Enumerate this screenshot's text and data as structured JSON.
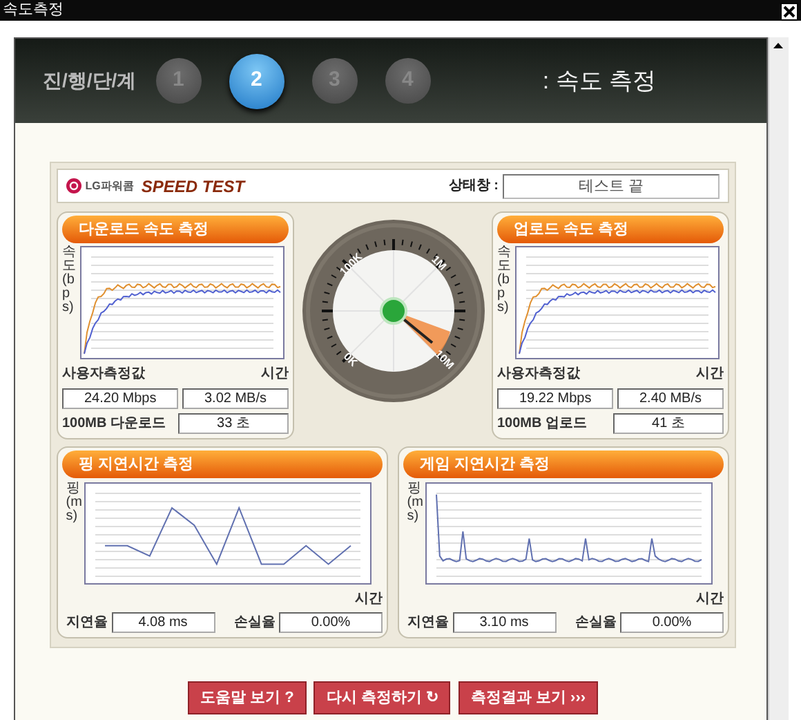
{
  "window": {
    "title": "속도측정"
  },
  "steps": {
    "label": "진/행/단/계",
    "items": [
      {
        "label": "1",
        "selected": false
      },
      {
        "label": "2",
        "selected": true
      },
      {
        "label": "3",
        "selected": false
      },
      {
        "label": "4",
        "selected": false
      }
    ],
    "current": ": 속도 측정"
  },
  "header": {
    "logo": "LG파워콤",
    "title": "SPEED TEST",
    "status_label": "상태창 :",
    "status_value": "테스트 끝"
  },
  "download": {
    "title": "다운로드 속도 측정",
    "ylabel": "속도(bps)",
    "xlabel": "시간",
    "measured_label": "사용자측정값",
    "mbps": "24.20 Mbps",
    "mbs": "3.02 MB/s",
    "time_label": "100MB 다운로드",
    "time": "33 초"
  },
  "gauge": {
    "labels": [
      "100K",
      "1M",
      "10M",
      "0K"
    ]
  },
  "upload": {
    "title": "업로드 속도 측정",
    "ylabel": "속도(bps)",
    "xlabel": "시간",
    "measured_label": "사용자측정값",
    "mbps": "19.22 Mbps",
    "mbs": "2.40 MB/s",
    "time_label": "100MB 업로드",
    "time": "41 초"
  },
  "ping": {
    "title": "핑 지연시간 측정",
    "ylabel": "핑(ms)",
    "xlabel": "시간",
    "latency_label": "지연율",
    "latency": "4.08 ms",
    "loss_label": "손실율",
    "loss": "0.00%"
  },
  "game": {
    "title": "게임 지연시간 측정",
    "ylabel": "핑(ms)",
    "xlabel": "시간",
    "latency_label": "지연율",
    "latency": "3.10 ms",
    "loss_label": "손실율",
    "loss": "0.00%"
  },
  "buttons": [
    {
      "label": "도움말 보기 ?"
    },
    {
      "label": "다시 측정하기 ↻"
    },
    {
      "label": "측정결과 보기 ›››"
    }
  ]
}
